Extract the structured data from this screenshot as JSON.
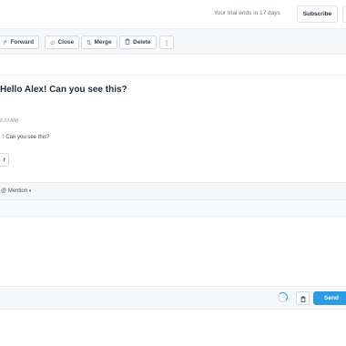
{
  "header": {
    "trial_text": "Your trial ends in 17 days",
    "subscribe_label": "Subscribe"
  },
  "toolbar": {
    "forward": {
      "icon": "forward-icon",
      "label": "Forward"
    },
    "close": {
      "icon": "close-circle-icon",
      "label": "Close"
    },
    "merge": {
      "icon": "merge-icon",
      "label": "Merge"
    },
    "delete": {
      "icon": "trash-icon",
      "label": "Delete"
    },
    "more_icon": "more-vertical-icon"
  },
  "message": {
    "subject": "Hello Alex! Can you see this?",
    "meta": "6:33 AM)",
    "body": "! Can you see this?",
    "reply_label": "r"
  },
  "editor": {
    "mention_label": "@ Mention",
    "send_label": "Send",
    "trash_icon": "trash-icon"
  },
  "colors": {
    "accent": "#2c9be6",
    "toolbar_bg": "#f5f7f9"
  }
}
